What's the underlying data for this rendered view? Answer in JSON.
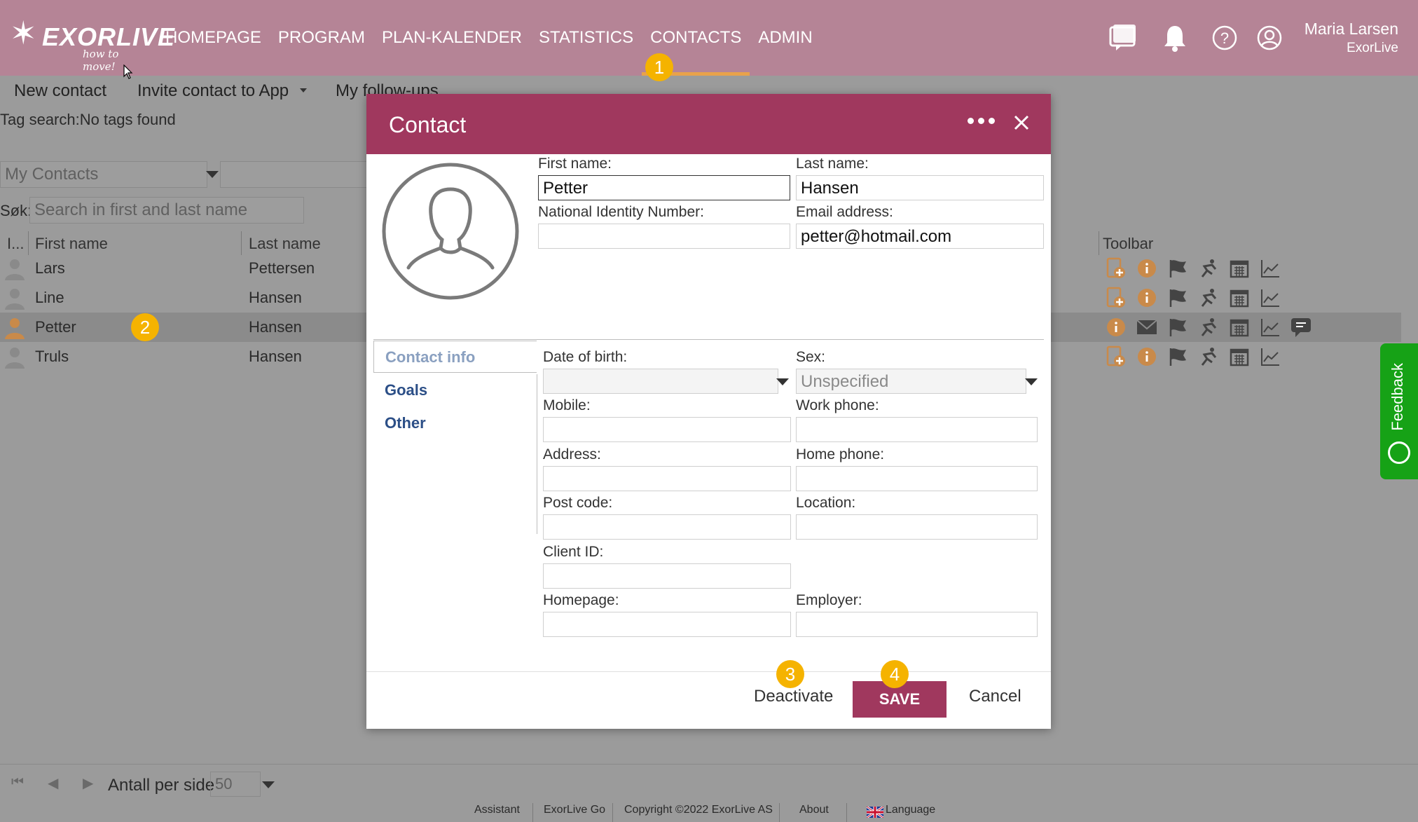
{
  "topbar": {
    "logo_text": "EXORLIVE",
    "logo_tagline": "how to move!",
    "nav": [
      "HOMEPAGE",
      "PROGRAM",
      "PLAN-KALENDER",
      "STATISTICS",
      "CONTACTS",
      "ADMIN"
    ],
    "active_nav": "CONTACTS",
    "user_name": "Maria Larsen",
    "user_org": "ExorLive",
    "icons": [
      "chat-icon",
      "bell-icon",
      "help-icon",
      "user-icon"
    ]
  },
  "subbar": {
    "new_contact": "New contact",
    "invite": "Invite contact to App",
    "followups": "My follow-ups"
  },
  "filters": {
    "tag_search": "Tag search:No tags found",
    "contacts_select": "My Contacts",
    "search_label": "Søk:",
    "search_placeholder": "Search in first and last name"
  },
  "grid": {
    "columns": [
      "I...",
      "First name",
      "Last name",
      "Toolbar"
    ],
    "rows": [
      {
        "first": "Lars",
        "last": "Pettersen"
      },
      {
        "first": "Line",
        "last": "Hansen"
      },
      {
        "first": "Petter",
        "last": "Hansen"
      },
      {
        "first": "Truls",
        "last": "Hansen"
      }
    ]
  },
  "feedback": "Feedback",
  "pager": {
    "label": "Antall per side",
    "value": "50"
  },
  "footer": [
    "Assistant",
    "ExorLive Go",
    "Copyright ©2022 ExorLive AS",
    "About",
    "Language"
  ],
  "badges": [
    "1",
    "2",
    "3",
    "4"
  ],
  "modal": {
    "title": "Contact",
    "first_name_label": "First name:",
    "first_name_value": "Petter",
    "last_name_label": "Last name:",
    "last_name_value": "Hansen",
    "nin_label": "National Identity Number:",
    "nin_value": "",
    "email_label": "Email address:",
    "email_value": "petter@hotmail.com",
    "tabs": [
      "Contact info",
      "Goals",
      "Other"
    ],
    "dob_label": "Date of birth:",
    "sex_label": "Sex:",
    "sex_value": "Unspecified",
    "mobile_label": "Mobile:",
    "work_phone_label": "Work phone:",
    "address_label": "Address:",
    "home_phone_label": "Home phone:",
    "post_code_label": "Post code:",
    "location_label": "Location:",
    "client_id_label": "Client ID:",
    "homepage_label": "Homepage:",
    "employer_label": "Employer:",
    "deactivate": "Deactivate",
    "save": "SAVE",
    "cancel": "Cancel"
  },
  "colors": {
    "topbar": "#b58496",
    "modal_header": "#a0385e",
    "accent_orange": "#f5b300",
    "feedback_green": "#16a216"
  }
}
